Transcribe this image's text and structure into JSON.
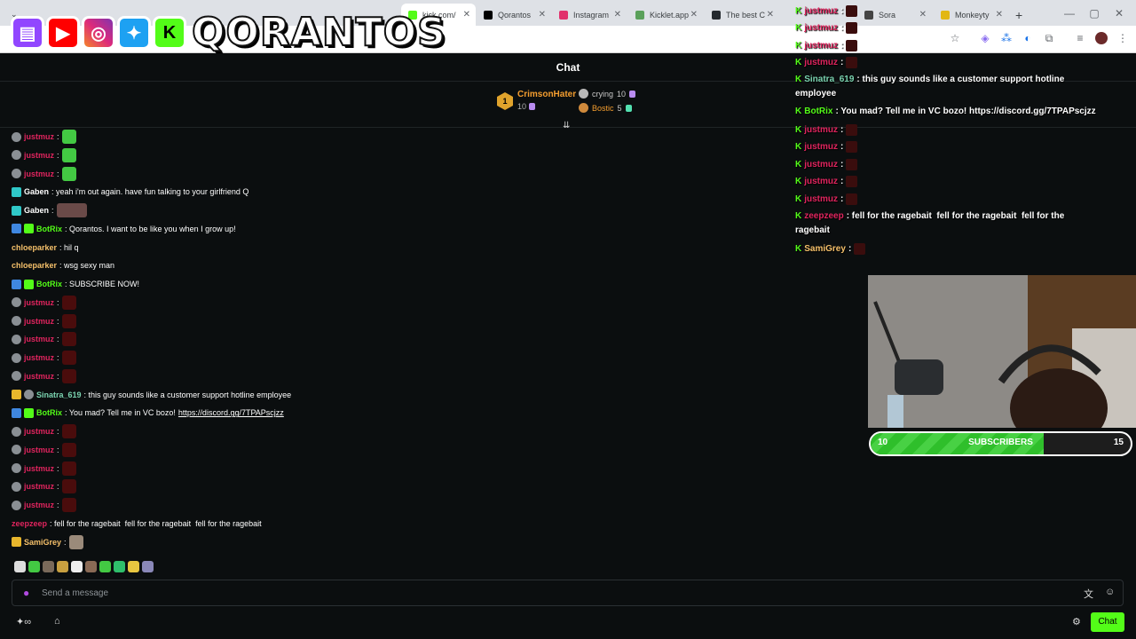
{
  "browser": {
    "tabs": [
      {
        "title": "kick.com/",
        "favicon": "kick-icon",
        "color": "#53fc18",
        "active": true
      },
      {
        "title": "Qorantos",
        "favicon": "tiktok-icon",
        "color": "#000000",
        "active": false
      },
      {
        "title": "Instagram",
        "favicon": "instagram-icon",
        "color": "#e1306c",
        "active": false
      },
      {
        "title": "Kicklet.app",
        "favicon": "kicklet-icon",
        "color": "#5aa05a",
        "active": false
      },
      {
        "title": "The best C",
        "favicon": "github-icon",
        "color": "#24292e",
        "active": false
      },
      {
        "title": "Sora",
        "favicon": "sora-icon",
        "color": "#444444",
        "active": false
      },
      {
        "title": "Monkeyty",
        "favicon": "monkeytype-icon",
        "color": "#e2b714",
        "active": false
      }
    ],
    "new_tab_label": "+"
  },
  "overlay": {
    "brand_icons": [
      "twitch-icon",
      "youtube-icon",
      "instagram-icon",
      "twitter-icon",
      "kick-icon"
    ],
    "streamer_name": "QORANTOS"
  },
  "chat": {
    "header_title": "Chat",
    "leaderboard": {
      "rank": "1",
      "top_user": "CrimsonHater",
      "top_amount": "10",
      "others": [
        {
          "name": "crying",
          "amount": "10",
          "color": "#b8b8b8"
        },
        {
          "name": "Bostic",
          "amount": "5",
          "color": "#f59e2f"
        }
      ]
    },
    "messages": [
      {
        "user": "justmuz",
        "color": "#e0245e",
        "text": ":",
        "emote": "green-blob-emote"
      },
      {
        "user": "justmuz",
        "color": "#e0245e",
        "text": ":",
        "emote": "green-blob-emote"
      },
      {
        "user": "justmuz",
        "color": "#e0245e",
        "text": ":",
        "emote": "green-blob-emote"
      },
      {
        "user": "Gaben",
        "color": "#ffffff",
        "text": ": yeah i'm out again. have fun talking to your girlfriend Q",
        "emote": ""
      },
      {
        "user": "Gaben",
        "color": "#ffffff",
        "text": ":",
        "emote": "photo-emote"
      },
      {
        "user": "BotRix",
        "color": "#53fc18",
        "text": ": Qorantos. I want to be like you when I grow up!",
        "emote": ""
      },
      {
        "user": "chloeparker",
        "color": "#f5c06a",
        "text": ": hil q",
        "emote": ""
      },
      {
        "user": "chloeparker",
        "color": "#f5c06a",
        "text": ": wsg sexy man",
        "emote": ""
      },
      {
        "user": "BotRix",
        "color": "#53fc18",
        "text": ": SUBSCRIBE NOW!",
        "emote": ""
      },
      {
        "user": "justmuz",
        "color": "#e0245e",
        "text": ":",
        "emote": "dark-face-emote"
      },
      {
        "user": "justmuz",
        "color": "#e0245e",
        "text": ":",
        "emote": "dark-face-emote"
      },
      {
        "user": "justmuz",
        "color": "#e0245e",
        "text": ":",
        "emote": "dark-face-emote"
      },
      {
        "user": "justmuz",
        "color": "#e0245e",
        "text": ":",
        "emote": "dark-face-emote"
      },
      {
        "user": "justmuz",
        "color": "#e0245e",
        "text": ":",
        "emote": "dark-face-emote"
      },
      {
        "user": "Sinatra_619",
        "color": "#7ad3b0",
        "text": ": this guy sounds like a customer support hotline employee",
        "emote": ""
      },
      {
        "user": "BotRix",
        "color": "#53fc18",
        "text": ": You mad? Tell me in VC bozo! ",
        "emote": "",
        "link": "https://discord.gg/7TPAPscjzz"
      },
      {
        "user": "justmuz",
        "color": "#e0245e",
        "text": ":",
        "emote": "dark-face-emote"
      },
      {
        "user": "justmuz",
        "color": "#e0245e",
        "text": ":",
        "emote": "dark-face-emote"
      },
      {
        "user": "justmuz",
        "color": "#e0245e",
        "text": ":",
        "emote": "dark-face-emote"
      },
      {
        "user": "justmuz",
        "color": "#e0245e",
        "text": ":",
        "emote": "dark-face-emote"
      },
      {
        "user": "justmuz",
        "color": "#e0245e",
        "text": ":",
        "emote": "dark-face-emote"
      },
      {
        "user": "zeepzeep",
        "color": "#e0245e",
        "text": ": fell for the ragebait  fell for the ragebait  fell for the ragebait",
        "emote": ""
      },
      {
        "user": "SamiGrey",
        "color": "#f5c06a",
        "text": ":",
        "emote": "person-emote"
      }
    ],
    "input_placeholder": "Send a message",
    "chat_button": "Chat"
  },
  "overlay_chat": [
    {
      "user": "justmuz",
      "color": "#e0245e",
      "text": ":"
    },
    {
      "user": "justmuz",
      "color": "#e0245e",
      "text": ":"
    },
    {
      "user": "justmuz",
      "color": "#e0245e",
      "text": ":"
    },
    {
      "user": "justmuz",
      "color": "#e0245e",
      "text": ":"
    },
    {
      "user": "Sinatra_619",
      "color": "#7ad3b0",
      "text": ": this guy sounds like a customer support hotline",
      "cont": "employee"
    },
    {
      "user": "BotRix",
      "color": "#53fc18",
      "text": ": You mad? Tell me in VC bozo! https://discord.gg/7TPAPscjzz"
    },
    {
      "user": "justmuz",
      "color": "#e0245e",
      "text": ":"
    },
    {
      "user": "justmuz",
      "color": "#e0245e",
      "text": ":"
    },
    {
      "user": "justmuz",
      "color": "#e0245e",
      "text": ":"
    },
    {
      "user": "justmuz",
      "color": "#e0245e",
      "text": ":"
    },
    {
      "user": "justmuz",
      "color": "#e0245e",
      "text": ":"
    },
    {
      "user": "zeepzeep",
      "color": "#e0245e",
      "text": ": fell for the ragebait  fell for the ragebait  fell for the",
      "cont": "ragebait"
    },
    {
      "user": "SamiGrey",
      "color": "#f5c06a",
      "text": ":"
    }
  ],
  "subscriber_goal": {
    "current": "10",
    "label": "SUBSCRIBERS",
    "target": "15",
    "progress_fraction": 0.667
  }
}
